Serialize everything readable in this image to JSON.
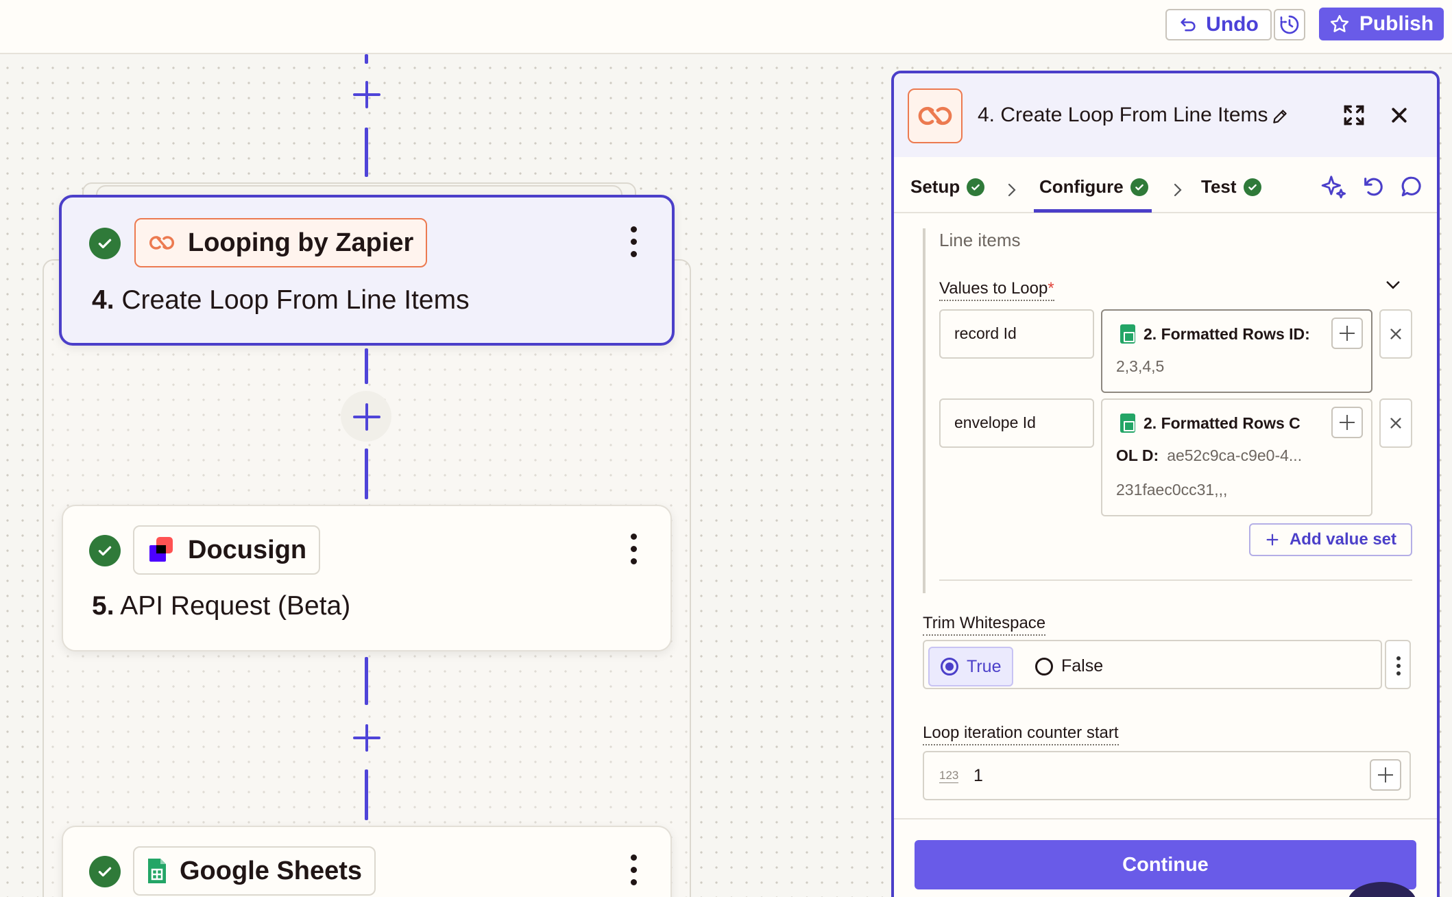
{
  "topbar": {
    "undo_label": "Undo",
    "publish_label": "Publish"
  },
  "canvas": {
    "cards": [
      {
        "app_name": "Looping by Zapier",
        "step_number": "4.",
        "step_title": "Create Loop From Line Items",
        "status": "complete",
        "selected": true,
        "app_icon": "loop-icon"
      },
      {
        "app_name": "Docusign",
        "step_number": "5.",
        "step_title": "API Request (Beta)",
        "status": "complete",
        "selected": false,
        "app_icon": "docusign-icon"
      },
      {
        "app_name": "Google Sheets",
        "step_number": "",
        "step_title": "",
        "status": "complete",
        "selected": false,
        "app_icon": "google-sheets-icon"
      }
    ]
  },
  "panel": {
    "title": "4. Create Loop From Line Items",
    "tabs": [
      {
        "label": "Setup",
        "done": true
      },
      {
        "label": "Configure",
        "done": true,
        "active": true
      },
      {
        "label": "Test",
        "done": true
      }
    ],
    "section_label": "Line items",
    "values_to_loop": {
      "label": "Values to Loop",
      "required_mark": "*",
      "rows": [
        {
          "key": "record Id",
          "token_label": "2. Formatted Rows ID:",
          "token_value": "2,3,4,5"
        },
        {
          "key": "envelope Id",
          "token_label": "2. Formatted Rows C",
          "token_label_cont": "OL D:",
          "token_value": "ae52c9ca-c9e0-4...",
          "token_value_cont": "231faec0cc31,,,"
        }
      ],
      "add_value_set_label": "Add value set"
    },
    "trim_whitespace": {
      "label": "Trim Whitespace",
      "options": [
        "True",
        "False"
      ],
      "selected": "True"
    },
    "loop_counter": {
      "label": "Loop iteration counter start",
      "type_hint": "123",
      "value": "1"
    },
    "continue_label": "Continue"
  },
  "colors": {
    "accent": "#695be8",
    "selected_border": "#4b3fc9",
    "success": "#2f7a39",
    "zapier_orange": "#ec7a50"
  }
}
